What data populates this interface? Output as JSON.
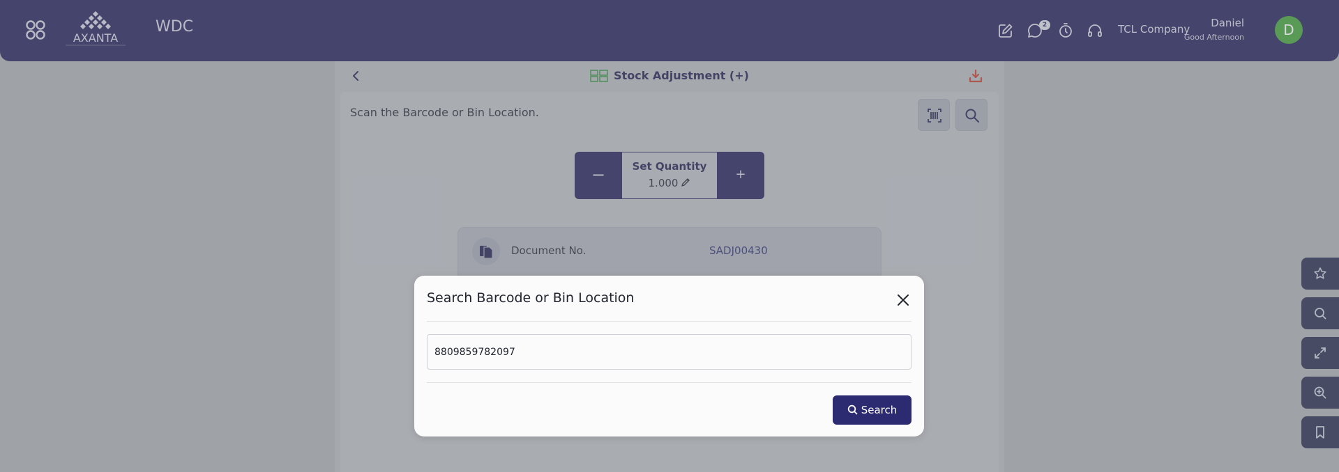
{
  "header": {
    "app_name": "WDC",
    "notification_count": "2",
    "company": "TCL Company",
    "user_name": "Daniel",
    "greeting": "Good Afternoon",
    "avatar_letter": "D"
  },
  "page": {
    "title": "Stock Adjustment (+)",
    "scan_prompt": "Scan the Barcode or Bin Location."
  },
  "quantity": {
    "minus": "−",
    "label": "Set Quantity",
    "value": "1.000",
    "plus": "+"
  },
  "document": {
    "label": "Document No.",
    "value": "SADJ00430"
  },
  "modal": {
    "title": "Search Barcode or Bin Location",
    "input_value": "8809859782097",
    "search_label": "Search"
  },
  "colors": {
    "brand_navy": "#1f1b57",
    "accent_red": "#c0392b",
    "avatar_green": "#3e9e35"
  }
}
